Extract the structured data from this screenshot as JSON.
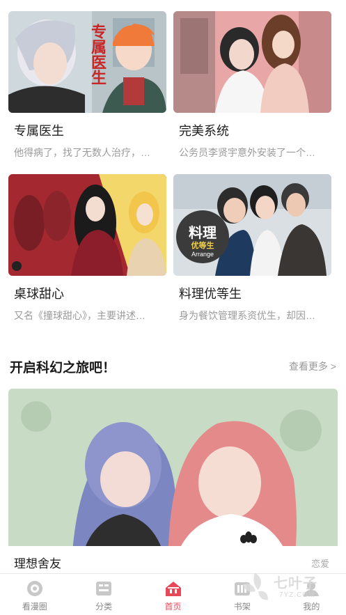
{
  "comics": [
    {
      "title": "专属医生",
      "desc": "他得病了，找了无数人治疗，…",
      "cover_text": "专属医生",
      "cover_icon": "doctor-cover"
    },
    {
      "title": "完美系统",
      "desc": "公务员李贤宇意外安装了一个…",
      "cover_icon": "system-cover"
    },
    {
      "title": "桌球甜心",
      "desc": "又名《撞球甜心》，主要讲述…",
      "cover_icon": "billiard-cover"
    },
    {
      "title": "料理优等生",
      "desc": "身为餐饮管理系资优生，却因…",
      "cover_text": "料理",
      "cover_sub": "优等生",
      "cover_en": "Arrange",
      "cover_icon": "cooking-cover"
    }
  ],
  "section": {
    "title": "开启科幻之旅吧！",
    "more": "查看更多 >"
  },
  "feature": {
    "title": "理想舍友",
    "tag": "恋爱",
    "cover_icon": "roommate-cover",
    "brand_mark": "adidas-trefoil"
  },
  "tabs": [
    {
      "label": "看漫圈",
      "icon": "circle-icon",
      "active": false
    },
    {
      "label": "分类",
      "icon": "category-icon",
      "active": false
    },
    {
      "label": "首页",
      "icon": "home-icon",
      "active": true
    },
    {
      "label": "书架",
      "icon": "bookshelf-icon",
      "active": false
    },
    {
      "label": "我的",
      "icon": "profile-icon",
      "active": false
    }
  ],
  "watermark": {
    "text": "七叶子",
    "sub": "7YZ.COM"
  },
  "colors": {
    "accent": "#e5495a",
    "muted": "#999999",
    "feature_bg": "#c7dbc4"
  }
}
